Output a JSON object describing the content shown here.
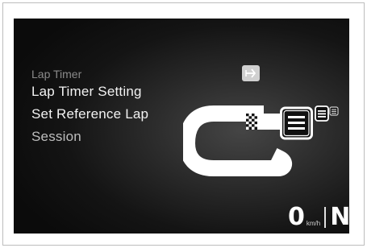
{
  "menu": {
    "header": "Lap Timer",
    "items": [
      {
        "label": "Lap Timer Setting"
      },
      {
        "label": "Set Reference Lap"
      },
      {
        "label": "Session"
      }
    ]
  },
  "icons": {
    "enter": "enter-icon",
    "track": "race-track-icon",
    "finish_flag": "checkered-flag-icon",
    "lap_list": "lap-list-icon"
  },
  "status": {
    "speed": "0",
    "speed_unit": "km/h",
    "gear": "N"
  }
}
